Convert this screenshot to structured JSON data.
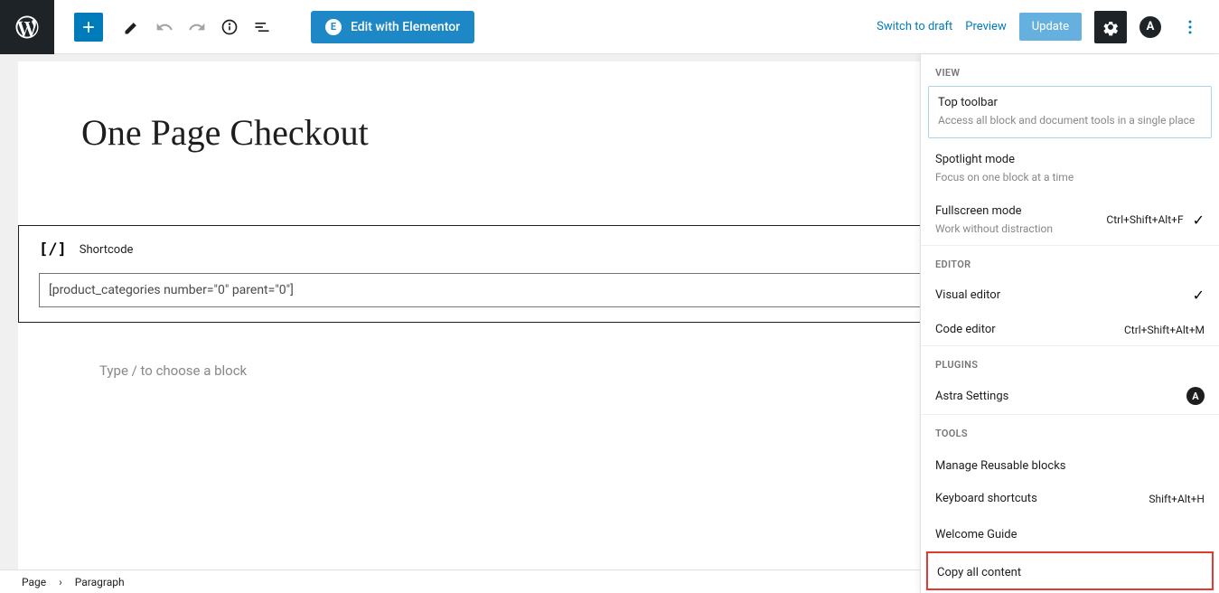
{
  "toolbar": {
    "elementor_label": "Edit with Elementor",
    "switch_draft": "Switch to draft",
    "preview": "Preview",
    "update": "Update"
  },
  "page": {
    "title": "One Page Checkout",
    "shortcode_label": "Shortcode",
    "shortcode_value": "[product_categories number=\"0\" parent=\"0\"]",
    "paragraph_placeholder": "Type / to choose a block"
  },
  "breadcrumb": {
    "root": "Page",
    "current": "Paragraph"
  },
  "dropdown": {
    "view_label": "VIEW",
    "top_toolbar": {
      "title": "Top toolbar",
      "desc": "Access all block and document tools in a single place"
    },
    "spotlight": {
      "title": "Spotlight mode",
      "desc": "Focus on one block at a time"
    },
    "fullscreen": {
      "title": "Fullscreen mode",
      "desc": "Work without distraction",
      "shortcut": "Ctrl+Shift+Alt+F"
    },
    "editor_label": "EDITOR",
    "visual_editor": "Visual editor",
    "code_editor": {
      "title": "Code editor",
      "shortcut": "Ctrl+Shift+Alt+M"
    },
    "plugins_label": "PLUGINS",
    "astra_settings": "Astra Settings",
    "tools_label": "TOOLS",
    "manage_reusable": "Manage Reusable blocks",
    "keyboard_shortcuts": {
      "title": "Keyboard shortcuts",
      "shortcut": "Shift+Alt+H"
    },
    "welcome_guide": "Welcome Guide",
    "copy_all": "Copy all content"
  }
}
